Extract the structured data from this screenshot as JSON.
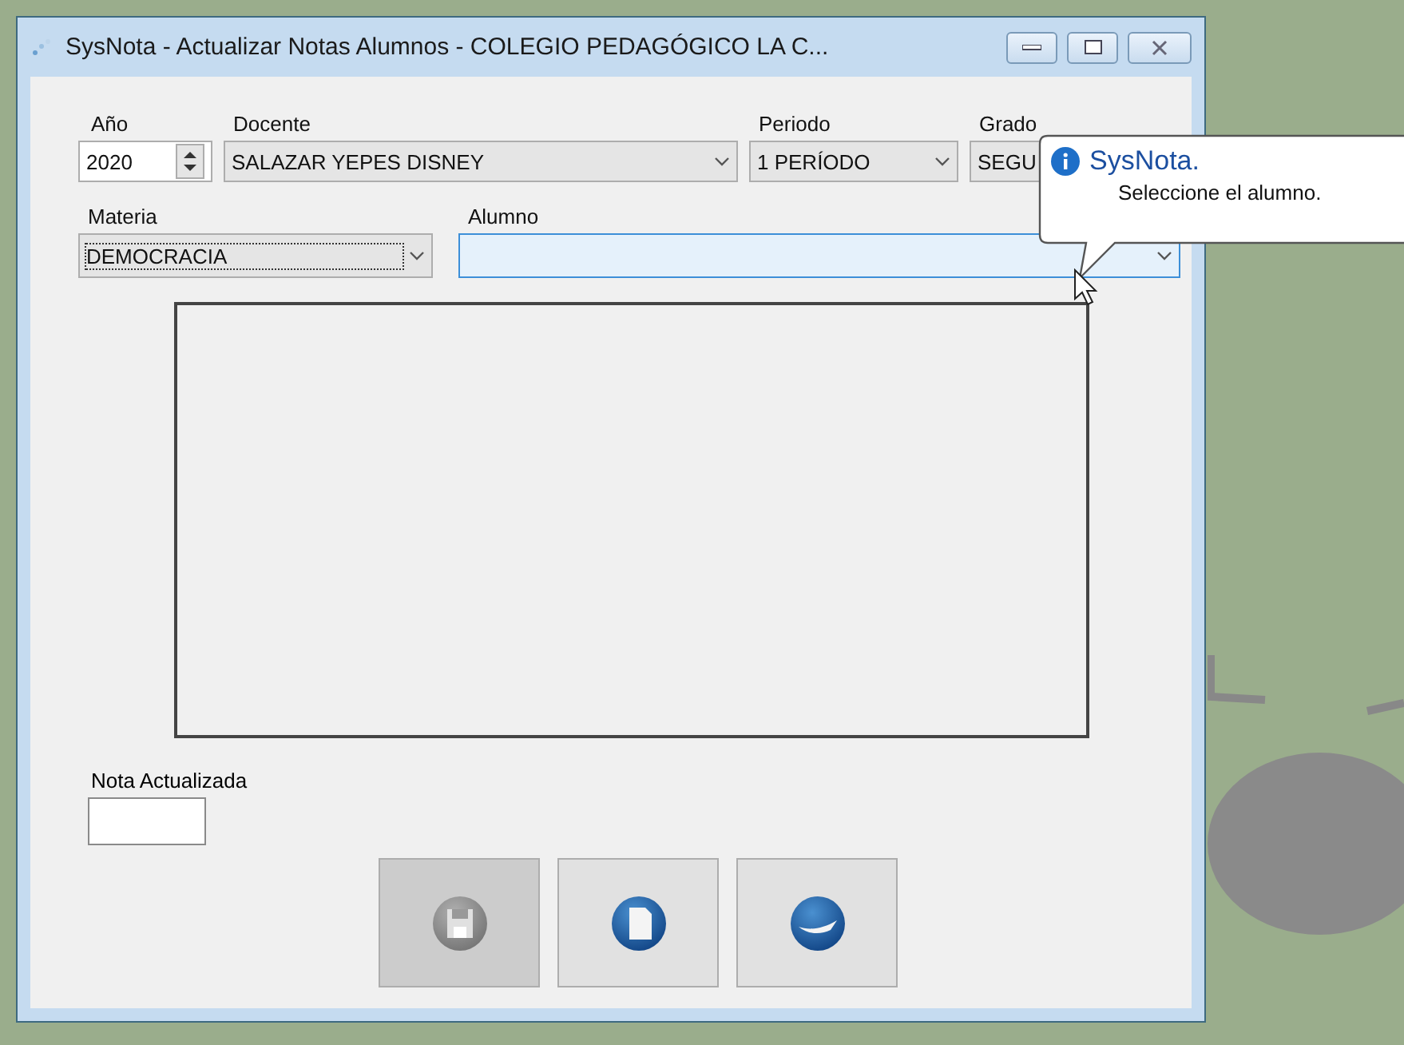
{
  "window": {
    "title": "SysNota - Actualizar Notas Alumnos - COLEGIO PEDAGÓGICO LA C..."
  },
  "field_rows": [
    {
      "fields": [
        {
          "label": "Año",
          "kind": "spinner",
          "value": "2020",
          "focused": false,
          "hovered": false
        },
        {
          "label": "Docente",
          "kind": "dropdown",
          "value": "SALAZAR YEPES DISNEY",
          "focused": false,
          "hovered": false
        },
        {
          "label": "Periodo",
          "kind": "dropdown",
          "value": "1 PERÍODO",
          "focused": false,
          "hovered": false
        },
        {
          "label": "Grado",
          "kind": "dropdown",
          "value": "SEGU",
          "focused": false,
          "hovered": false
        }
      ]
    },
    {
      "fields": [
        {
          "label": "Materia",
          "kind": "dropdown",
          "value": "DEMOCRACIA",
          "focused": true,
          "hovered": false
        },
        {
          "label": "Alumno",
          "kind": "combo",
          "focused": false,
          "hovered": true
        }
      ]
    }
  ],
  "nota": {
    "label": "Nota Actualizada"
  },
  "buttons": [
    {
      "kind": "save",
      "disabled": true
    },
    {
      "kind": "document",
      "disabled": false
    },
    {
      "kind": "exit",
      "disabled": false
    }
  ],
  "tooltip": {
    "title": "SysNota.",
    "message": "Seleccione el alumno."
  }
}
